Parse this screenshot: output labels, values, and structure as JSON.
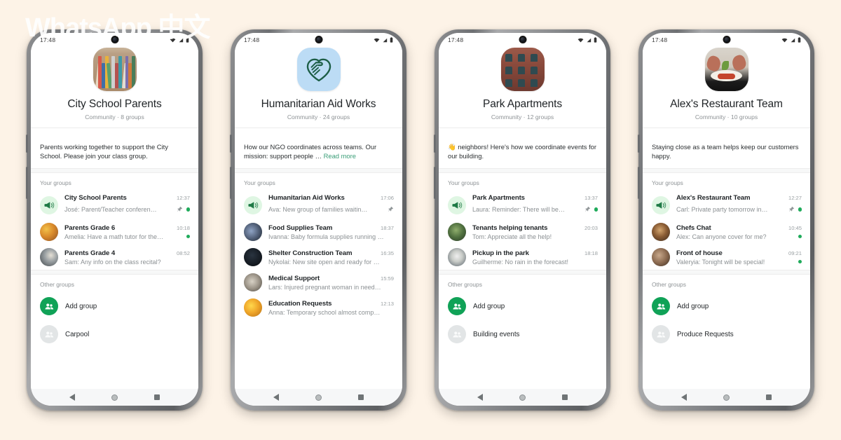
{
  "watermark": "WhatsApp 中文",
  "status_bar": {
    "time": "17:48",
    "icons": [
      "wifi-icon",
      "signal-icon",
      "battery-icon"
    ]
  },
  "nav_bar": {
    "back": "back-triangle-icon",
    "home": "home-circle-icon",
    "recents": "recents-square-icon"
  },
  "common": {
    "back_icon": "back-arrow-icon",
    "menu_icon": "overflow-menu-icon",
    "your_groups_label": "Your groups",
    "other_groups_label": "Other groups",
    "add_group_label": "Add group",
    "read_more_label": "Read more"
  },
  "colors": {
    "page_background": "#fdf3e7",
    "accent_green": "#10a257",
    "unread_dot": "#1fab5b",
    "link_green": "#3a9e78",
    "announcement_bg": "#dff6e3",
    "title_text": "#1f2326",
    "secondary_text": "#8d9295"
  },
  "phones": [
    {
      "community": {
        "name": "City School Parents",
        "meta": "Community · 8 groups",
        "description": "Parents working together to support the City School. Please join your class group.",
        "truncated": false,
        "avatar": "books-photo"
      },
      "your_groups": [
        {
          "name": "City School Parents",
          "message": "José: Parent/Teacher conferen…",
          "time": "12:37",
          "avatar": "announcement-megaphone-icon",
          "announcement": true,
          "pinned": true,
          "unread": true
        },
        {
          "name": "Parents Grade 6",
          "message": "Amelia: Have a math tutor for the…",
          "time": "10:18",
          "avatar": "group-photo",
          "announcement": false,
          "pinned": false,
          "unread": true
        },
        {
          "name": "Parents Grade 4",
          "message": "Sam: Any info on the class recital?",
          "time": "08:52",
          "avatar": "group-photo",
          "announcement": false,
          "pinned": false,
          "unread": false
        }
      ],
      "other_groups": [
        {
          "label": "Add group",
          "icon": "add-group-icon",
          "style": "green"
        },
        {
          "label": "Carpool",
          "icon": "group-placeholder-icon",
          "style": "grey"
        }
      ]
    },
    {
      "community": {
        "name": "Humanitarian Aid Works",
        "meta": "Community · 24 groups",
        "description": "How our NGO coordinates across teams. Our mission: support people …",
        "truncated": true,
        "avatar": "heart-handshake-icon"
      },
      "your_groups": [
        {
          "name": "Humanitarian Aid Works",
          "message": "Ava: New group of families waitin…",
          "time": "17:06",
          "avatar": "announcement-megaphone-icon",
          "announcement": true,
          "pinned": true,
          "unread": false
        },
        {
          "name": "Food Supplies Team",
          "message": "Ivanna: Baby formula supplies running …",
          "time": "18:37",
          "avatar": "group-photo",
          "announcement": false,
          "pinned": false,
          "unread": false
        },
        {
          "name": "Shelter Construction Team",
          "message": "Nykolai: New site open and ready for …",
          "time": "16:35",
          "avatar": "group-photo",
          "announcement": false,
          "pinned": false,
          "unread": false
        },
        {
          "name": "Medical Support",
          "message": "Lars: Injured pregnant woman in need…",
          "time": "15:59",
          "avatar": "group-photo",
          "announcement": false,
          "pinned": false,
          "unread": false
        },
        {
          "name": "Education Requests",
          "message": "Anna: Temporary school almost comp…",
          "time": "12:13",
          "avatar": "group-photo",
          "announcement": false,
          "pinned": false,
          "unread": false
        }
      ],
      "other_groups": []
    },
    {
      "community": {
        "name": "Park Apartments",
        "meta": "Community · 12 groups",
        "description": "👋 neighbors! Here's how we coordinate events for our building.",
        "truncated": false,
        "avatar": "building-photo"
      },
      "your_groups": [
        {
          "name": "Park Apartments",
          "message": "Laura: Reminder: There will be…",
          "time": "13:37",
          "avatar": "announcement-megaphone-icon",
          "announcement": true,
          "pinned": true,
          "unread": true
        },
        {
          "name": "Tenants helping tenants",
          "message": "Tom: Appreciate all the help!",
          "time": "20:03",
          "avatar": "group-photo",
          "announcement": false,
          "pinned": false,
          "unread": false
        },
        {
          "name": "Pickup in the park",
          "message": "Guilherme: No rain in the forecast!",
          "time": "18:18",
          "avatar": "group-photo",
          "announcement": false,
          "pinned": false,
          "unread": false
        }
      ],
      "other_groups": [
        {
          "label": "Add group",
          "icon": "add-group-icon",
          "style": "green"
        },
        {
          "label": "Building events",
          "icon": "group-placeholder-icon",
          "style": "grey"
        }
      ]
    },
    {
      "community": {
        "name": "Alex's Restaurant Team",
        "meta": "Community · 10 groups",
        "description": "Staying close as a team helps keep our customers happy.",
        "truncated": false,
        "avatar": "food-photo"
      },
      "your_groups": [
        {
          "name": "Alex's Restaurant Team",
          "message": "Carl: Private party tomorrow in…",
          "time": "12:27",
          "avatar": "announcement-megaphone-icon",
          "announcement": true,
          "pinned": true,
          "unread": true
        },
        {
          "name": "Chefs Chat",
          "message": "Alex: Can anyone cover for me?",
          "time": "10:45",
          "avatar": "group-photo",
          "announcement": false,
          "pinned": false,
          "unread": true
        },
        {
          "name": "Front of house",
          "message": "Valeryia: Tonight will be special!",
          "time": "09:21",
          "avatar": "group-photo",
          "announcement": false,
          "pinned": false,
          "unread": true
        }
      ],
      "other_groups": [
        {
          "label": "Add group",
          "icon": "add-group-icon",
          "style": "green"
        },
        {
          "label": "Produce Requests",
          "icon": "group-placeholder-icon",
          "style": "grey"
        }
      ]
    }
  ]
}
